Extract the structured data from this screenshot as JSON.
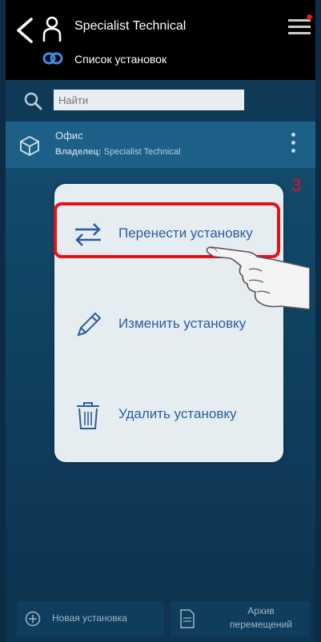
{
  "header": {
    "user_name": "Specialist Technical",
    "subtitle": "Список установок"
  },
  "search": {
    "placeholder": "Найти"
  },
  "installation": {
    "name": "Офис",
    "owner_label": "Владелец:",
    "owner_name": "Specialist Technical"
  },
  "popup": {
    "options": [
      {
        "label": "Перенести установку",
        "icon": "transfer-arrows-icon"
      },
      {
        "label": "Изменить установку",
        "icon": "pencil-icon"
      },
      {
        "label": "Удалить установку",
        "icon": "trash-icon"
      }
    ]
  },
  "annotation": {
    "step": "3"
  },
  "bottom": {
    "new_label": "Новая установка",
    "archive_line1": "Архив",
    "archive_line2": "перемещений"
  },
  "colors": {
    "accent_blue": "#2a5ea0",
    "highlight_red": "#e4101b"
  }
}
